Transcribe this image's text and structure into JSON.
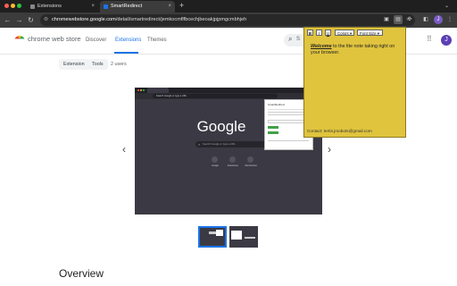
{
  "browser": {
    "tabs": [
      {
        "label": "Extensions",
        "active": false
      },
      {
        "label": "SmartRedirect",
        "active": true
      }
    ],
    "new_tab": "+",
    "url_host": "chromewebstore.google.com",
    "url_path": "/detail/smartredirect/jemkocmflfbcechjbeoakjpjpmgcmbhjeh",
    "avatar_letter": "J"
  },
  "store": {
    "name": "chrome web store",
    "nav": [
      "Discover",
      "Extensions",
      "Themes"
    ],
    "search_label": "S",
    "chips": [
      "Extension",
      "Tools"
    ],
    "users": "2 users"
  },
  "screenshot": {
    "url": "Search Google or type a URL",
    "google": "Google",
    "search_placeholder": "Search Google or type a URL",
    "shortcuts": [
      "Google",
      "Extensions",
      "Add shortcut"
    ],
    "popup_title": "SmartRedirect"
  },
  "section_title": "Overview",
  "note": {
    "bold_btn": "B",
    "italic_btn": "I",
    "underline_btn": "U",
    "colors": "Colors",
    "font_size": "Font Size",
    "welcome": "Welcome",
    "body_rest": " to the lite note taking right on your browser.",
    "contact": "Contact: tertis.jmobots@gmail.com"
  },
  "colors": {
    "accent": "#1a73e8",
    "note_bg": "#e0c43e",
    "chrome_dark": "#1f1f1f"
  }
}
